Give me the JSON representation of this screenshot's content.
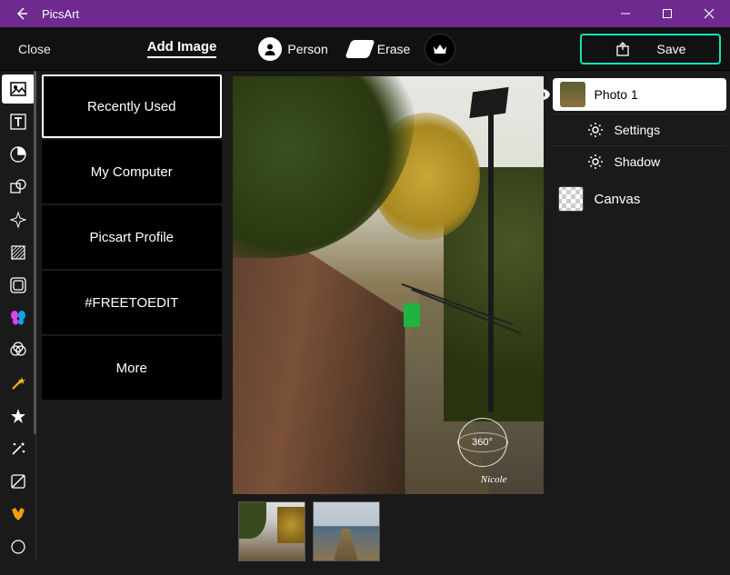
{
  "titlebar": {
    "app_name": "PicsArt"
  },
  "toolbar": {
    "close": "Close",
    "add_image": "Add Image",
    "person": "Person",
    "erase": "Erase",
    "save": "Save"
  },
  "sources": {
    "items": [
      "Recently Used",
      "My Computer",
      "Picsart Profile",
      "#FREETOEDIT",
      "More"
    ]
  },
  "canvas": {
    "badge360": "360°",
    "watermark": "Nicole"
  },
  "layers": {
    "photo1": "Photo 1",
    "settings": "Settings",
    "shadow": "Shadow",
    "canvas": "Canvas"
  }
}
